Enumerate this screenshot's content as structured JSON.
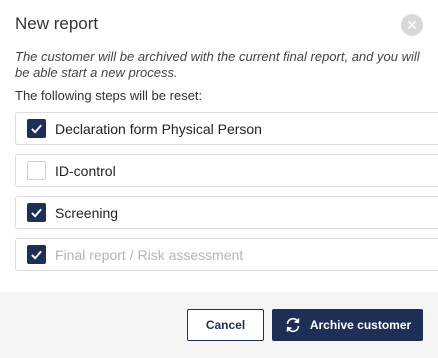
{
  "dialog": {
    "title": "New report",
    "close_icon": "close-icon",
    "description": "The customer will be archived with the current final report, and you will be able start a new process.",
    "subtitle": "The following steps will be reset:"
  },
  "steps": [
    {
      "label": "Declaration form Physical Person",
      "checked": true,
      "disabled": false
    },
    {
      "label": "ID-control",
      "checked": false,
      "disabled": false
    },
    {
      "label": "Screening",
      "checked": true,
      "disabled": false
    },
    {
      "label": "Final report / Risk assessment",
      "checked": true,
      "disabled": true
    }
  ],
  "footer": {
    "cancel_label": "Cancel",
    "archive_label": "Archive customer",
    "archive_icon": "sync-icon"
  },
  "colors": {
    "accent": "#1e2f57",
    "footer_bg": "#f5f5f5",
    "disabled_text": "#b5b5b5"
  }
}
